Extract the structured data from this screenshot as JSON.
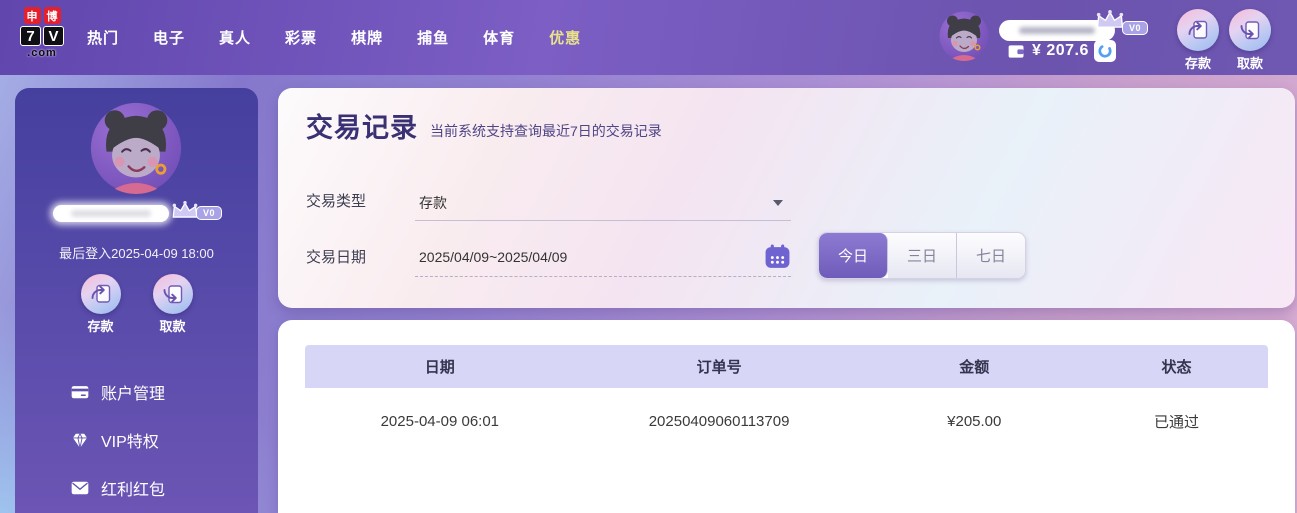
{
  "brand": {
    "cn_1": "申",
    "cn_2": "博",
    "num": "7",
    "letter": "V",
    "tld": ".com"
  },
  "navbar": {
    "items": [
      {
        "label": "热门"
      },
      {
        "label": "电子"
      },
      {
        "label": "真人"
      },
      {
        "label": "彩票"
      },
      {
        "label": "棋牌"
      },
      {
        "label": "捕鱼"
      },
      {
        "label": "体育"
      },
      {
        "label": "优惠"
      }
    ]
  },
  "user": {
    "vip_level": "V0",
    "balance": "¥ 207.6",
    "last_login": "最后登入2025-04-09 18:00"
  },
  "quick_actions": {
    "deposit": "存款",
    "withdraw": "取款"
  },
  "sidebar": {
    "menu": [
      {
        "label": "账户管理"
      },
      {
        "label": "VIP特权"
      },
      {
        "label": "红利红包"
      }
    ]
  },
  "main": {
    "title": "交易记录",
    "subtitle": "当前系统支持查询最近7日的交易记录",
    "filters": {
      "type_label": "交易类型",
      "type_value": "存款",
      "date_label": "交易日期",
      "date_value": "2025/04/09~2025/04/09",
      "ranges": [
        {
          "label": "今日",
          "active": true
        },
        {
          "label": "三日"
        },
        {
          "label": "七日"
        }
      ]
    },
    "table": {
      "headers": [
        "日期",
        "订单号",
        "金额",
        "状态"
      ],
      "rows": [
        [
          "2025-04-09 06:01",
          "20250409060113709",
          "¥205.00",
          "已通过"
        ]
      ]
    }
  },
  "colors": {
    "accent_purple": "#7058b8",
    "active_nav": "#e9e28b",
    "table_header_bg": "#d7d6f6",
    "active_range": "#7a66c4"
  }
}
